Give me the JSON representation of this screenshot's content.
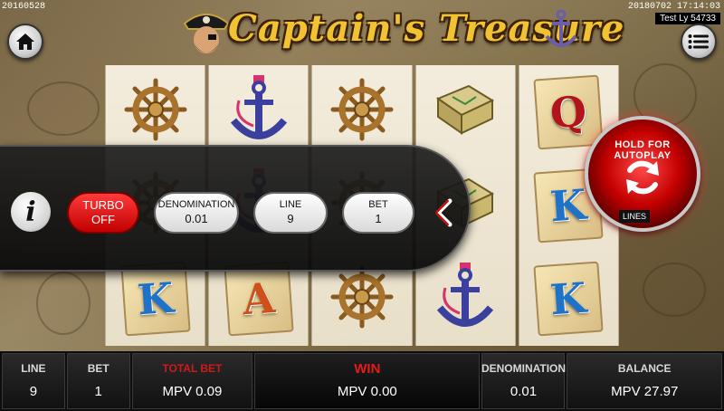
{
  "build_left": "20160528",
  "build_right": "20180702 17:14:03",
  "user_id": "Test Ly 54733",
  "logo_title": "Captain's Treasure",
  "reels": [
    [
      "wheel",
      "wheel",
      "king"
    ],
    [
      "anchor",
      "anchor",
      "ace"
    ],
    [
      "wheel",
      "wheel",
      "wheel"
    ],
    [
      "map",
      "map",
      "anchor"
    ],
    [
      "queen",
      "king",
      "king"
    ]
  ],
  "letters": {
    "queen": "Q",
    "king": "K",
    "ace": "A"
  },
  "controls": {
    "info_label": "i",
    "turbo_label": "TURBO",
    "turbo_value": "OFF",
    "denomination_label": "DENOMINATION",
    "denomination_value": "0.01",
    "line_label": "LINE",
    "line_value": "9",
    "bet_label": "BET",
    "bet_value": "1",
    "collapse_icon": "chevron-left-icon"
  },
  "autoplay_label": "HOLD FOR AUTOPLAY",
  "lines_tag": "LINES",
  "hud": {
    "line_label": "LINE",
    "line_value": "9",
    "bet_label": "BET",
    "bet_value": "1",
    "total_bet_label": "TOTAL BET",
    "total_bet_value": "MPV 0.09",
    "win_label": "WIN",
    "win_value": "MPV 0.00",
    "denomination_label": "DENOMINATION",
    "denomination_value": "0.01",
    "balance_label": "BALANCE",
    "balance_value": "MPV 27.97"
  },
  "colors": {
    "turbo": "#d10000",
    "autoplay": "#c40000",
    "total_bet_label": "#d11a1a",
    "win_label": "#e31b1b",
    "logo": "#f1c232"
  }
}
